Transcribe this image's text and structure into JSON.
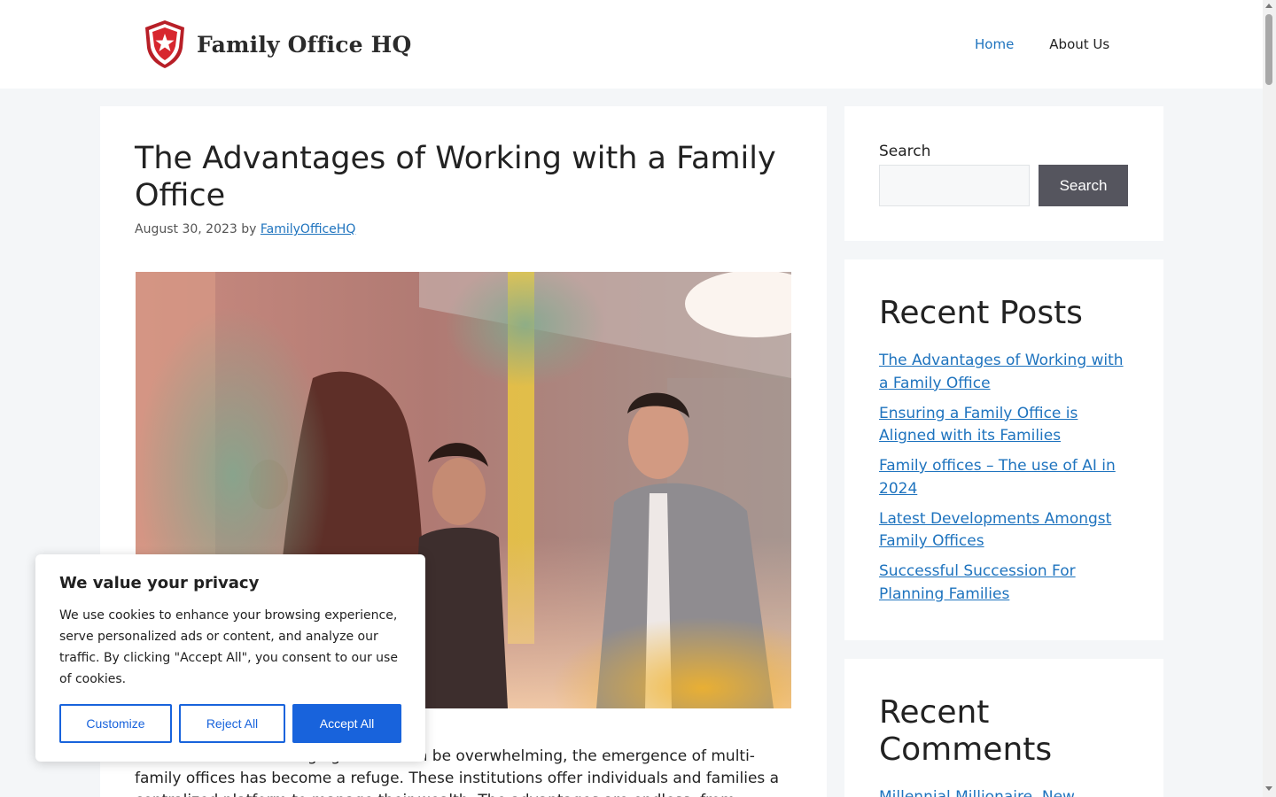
{
  "header": {
    "logo_text": "Family Office HQ",
    "nav": [
      {
        "label": "Home",
        "active": true
      },
      {
        "label": "About Us",
        "active": false
      }
    ]
  },
  "article": {
    "title": "The Advantages of Working with a Family Office",
    "date": "August 30, 2023",
    "by": "by",
    "author": "FamilyOfficeHQ",
    "body": "In a world where managing wealth can be overwhelming, the emergence of multi-family offices has become a refuge. These institutions offer individuals and families a centralized platform to manage their wealth. The advantages are endless, from"
  },
  "sidebar": {
    "search_label": "Search",
    "search_placeholder": "",
    "search_button": "Search",
    "recent_posts_title": "Recent Posts",
    "recent_posts": [
      {
        "label": "The Advantages of Working with a Family Office"
      },
      {
        "label": "Ensuring a Family Office is Aligned with its Families"
      },
      {
        "label": "Family offices – The use of AI in 2024"
      },
      {
        "label": "Latest Developments Amongst Family Offices"
      },
      {
        "label": "Successful Succession For Planning Families"
      }
    ],
    "recent_comments_title": "Recent Comments",
    "recent_comments_first": "Millennial Millionaire, New"
  },
  "cookie": {
    "title": "We value your privacy",
    "text": "We use cookies to enhance your browsing experience, serve personalized ads or content, and analyze our traffic. By clicking \"Accept All\", you consent to our use of cookies.",
    "customize": "Customize",
    "reject": "Reject All",
    "accept": "Accept All"
  },
  "colors": {
    "link": "#1e73be",
    "search_button": "#55555e",
    "cookie_accent": "#1863dc",
    "logo_red": "#d7262e"
  }
}
